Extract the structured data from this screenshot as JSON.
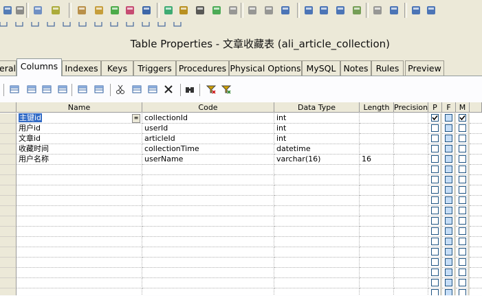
{
  "window": {
    "title": "Table Properties - 文章收藏表 (ali_article_collection)"
  },
  "tabs": [
    {
      "label": "eral",
      "active": false
    },
    {
      "label": "Columns",
      "active": true
    },
    {
      "label": "Indexes",
      "active": false
    },
    {
      "label": "Keys",
      "active": false
    },
    {
      "label": "Triggers",
      "active": false
    },
    {
      "label": "Procedures",
      "active": false
    },
    {
      "label": "Physical Options",
      "active": false
    },
    {
      "label": "MySQL",
      "active": false
    },
    {
      "label": "Notes",
      "active": false
    },
    {
      "label": "Rules",
      "active": false
    },
    {
      "label": "Preview",
      "active": false
    }
  ],
  "grid": {
    "headers": {
      "name": "Name",
      "code": "Code",
      "data_type": "Data Type",
      "length": "Length",
      "precision": "Precision",
      "p": "P",
      "f": "F",
      "m": "M"
    },
    "rows": [
      {
        "name": "主键id",
        "code": "collectionId",
        "data_type": "int",
        "length": "",
        "precision": "",
        "p": true,
        "f": false,
        "m": true
      },
      {
        "name": "用户id",
        "code": "userId",
        "data_type": "int",
        "length": "",
        "precision": "",
        "p": false,
        "f": false,
        "m": false
      },
      {
        "name": "文章id",
        "code": "articleId",
        "data_type": "int",
        "length": "",
        "precision": "",
        "p": false,
        "f": false,
        "m": false
      },
      {
        "name": "收藏时间",
        "code": "collectionTime",
        "data_type": "datetime",
        "length": "",
        "precision": "",
        "p": false,
        "f": false,
        "m": false
      },
      {
        "name": "用户名称",
        "code": "userName",
        "data_type": "varchar(16)",
        "length": "16",
        "precision": "",
        "p": false,
        "f": false,
        "m": false
      }
    ],
    "empty_rows": 13
  },
  "icons": {
    "top_toolbar": [
      "redo-icon",
      "properties-icon",
      "model-icon",
      "package-icon",
      "lock-icon",
      "open-icon",
      "refresh-icon",
      "check-icon",
      "shadow-icon",
      "add-icon",
      "pen-icon",
      "pointer-icon",
      "text-icon",
      "align-icon",
      "left-icon",
      "right-icon",
      "table-a-icon",
      "table-b-icon",
      "table-c-icon",
      "table-d-icon",
      "graph-icon",
      "filter-icon",
      "diagram-icon",
      "list-icon",
      "grid-icon"
    ],
    "grid_toolbar": [
      "insert-row-icon",
      "add-row-icon",
      "append-row-icon",
      "delete-rows-icon",
      "properties-icon",
      "domain-icon",
      "cut-icon",
      "copy-icon",
      "paste-icon",
      "delete-icon",
      "find-icon",
      "filter-icon",
      "clear-filter-icon"
    ]
  }
}
